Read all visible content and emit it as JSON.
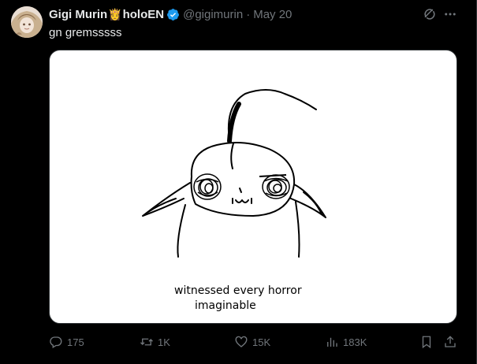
{
  "user": {
    "display_name": "Gigi Murin",
    "name_emoji": "👸",
    "affiliation": "holoEN",
    "handle": "@gigimurin",
    "separator": "·",
    "date": "May 20",
    "verified_color": "#1d9bf0"
  },
  "tweet": {
    "text": "gn gremsssss"
  },
  "media": {
    "caption_line1": "witnessed every horror",
    "caption_line2": "imaginable"
  },
  "actions": {
    "replies": "175",
    "reposts": "1K",
    "likes": "15K",
    "views": "183K"
  },
  "icons": {
    "reply": "reply-icon",
    "repost": "repost-icon",
    "like": "heart-icon",
    "views": "views-icon",
    "bookmark": "bookmark-icon",
    "share": "share-icon",
    "grok": "grok-icon",
    "more": "more-icon",
    "verified": "verified-badge-icon"
  },
  "colors": {
    "background": "#000000",
    "text": "#e7e9ea",
    "muted": "#71767b",
    "accent": "#1d9bf0"
  }
}
